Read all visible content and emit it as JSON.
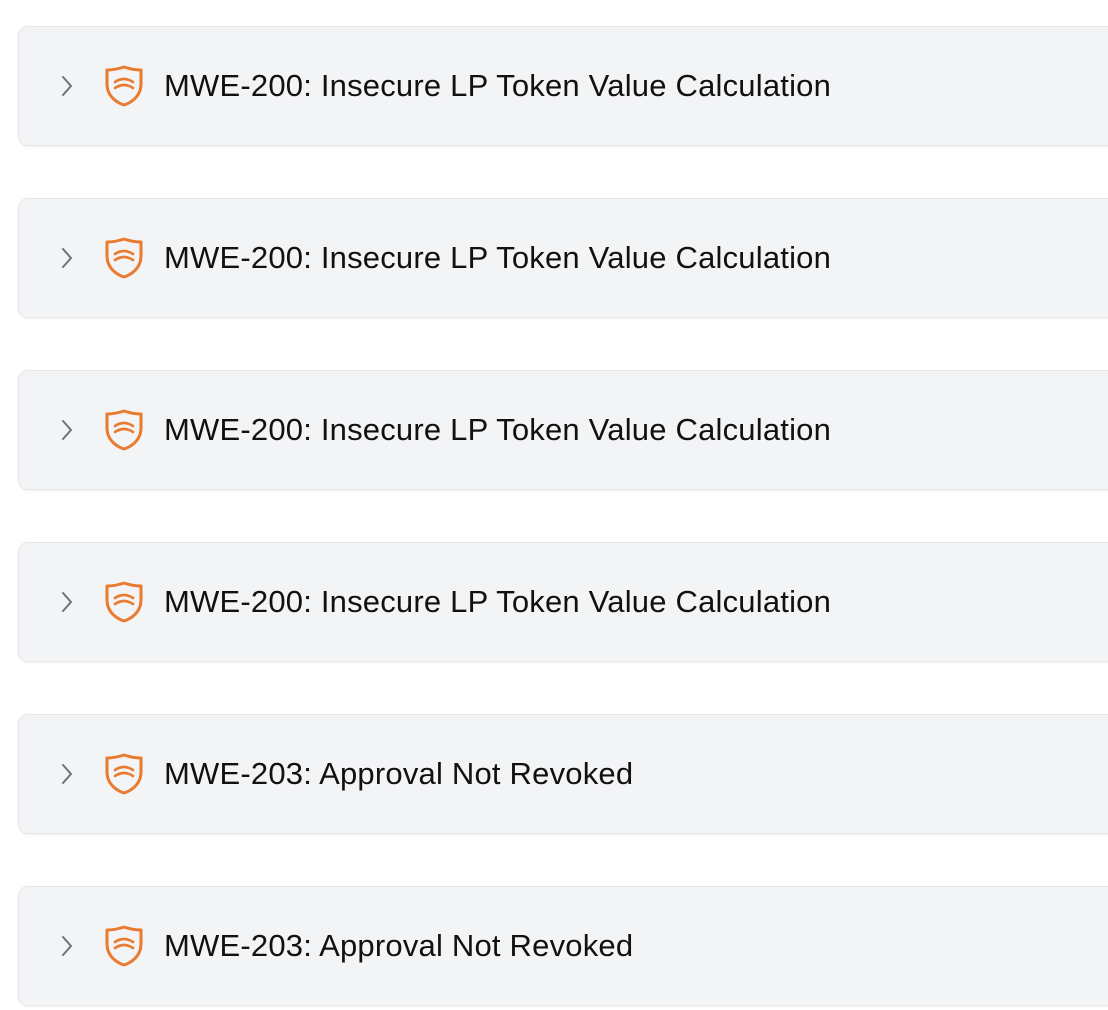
{
  "colors": {
    "row_background": "#f3f4f6",
    "row_border": "#e5e7eb",
    "shield_accent": "#e97a2f",
    "chevron": "#6b7280",
    "title_text": "#111111"
  },
  "icons": {
    "expand": "chevron-right-icon",
    "severity": "shield-icon"
  },
  "findings": [
    {
      "title": "MWE-200: Insecure LP Token Value Calculation"
    },
    {
      "title": "MWE-200: Insecure LP Token Value Calculation"
    },
    {
      "title": "MWE-200: Insecure LP Token Value Calculation"
    },
    {
      "title": "MWE-200: Insecure LP Token Value Calculation"
    },
    {
      "title": "MWE-203: Approval Not Revoked"
    },
    {
      "title": "MWE-203: Approval Not Revoked"
    }
  ]
}
